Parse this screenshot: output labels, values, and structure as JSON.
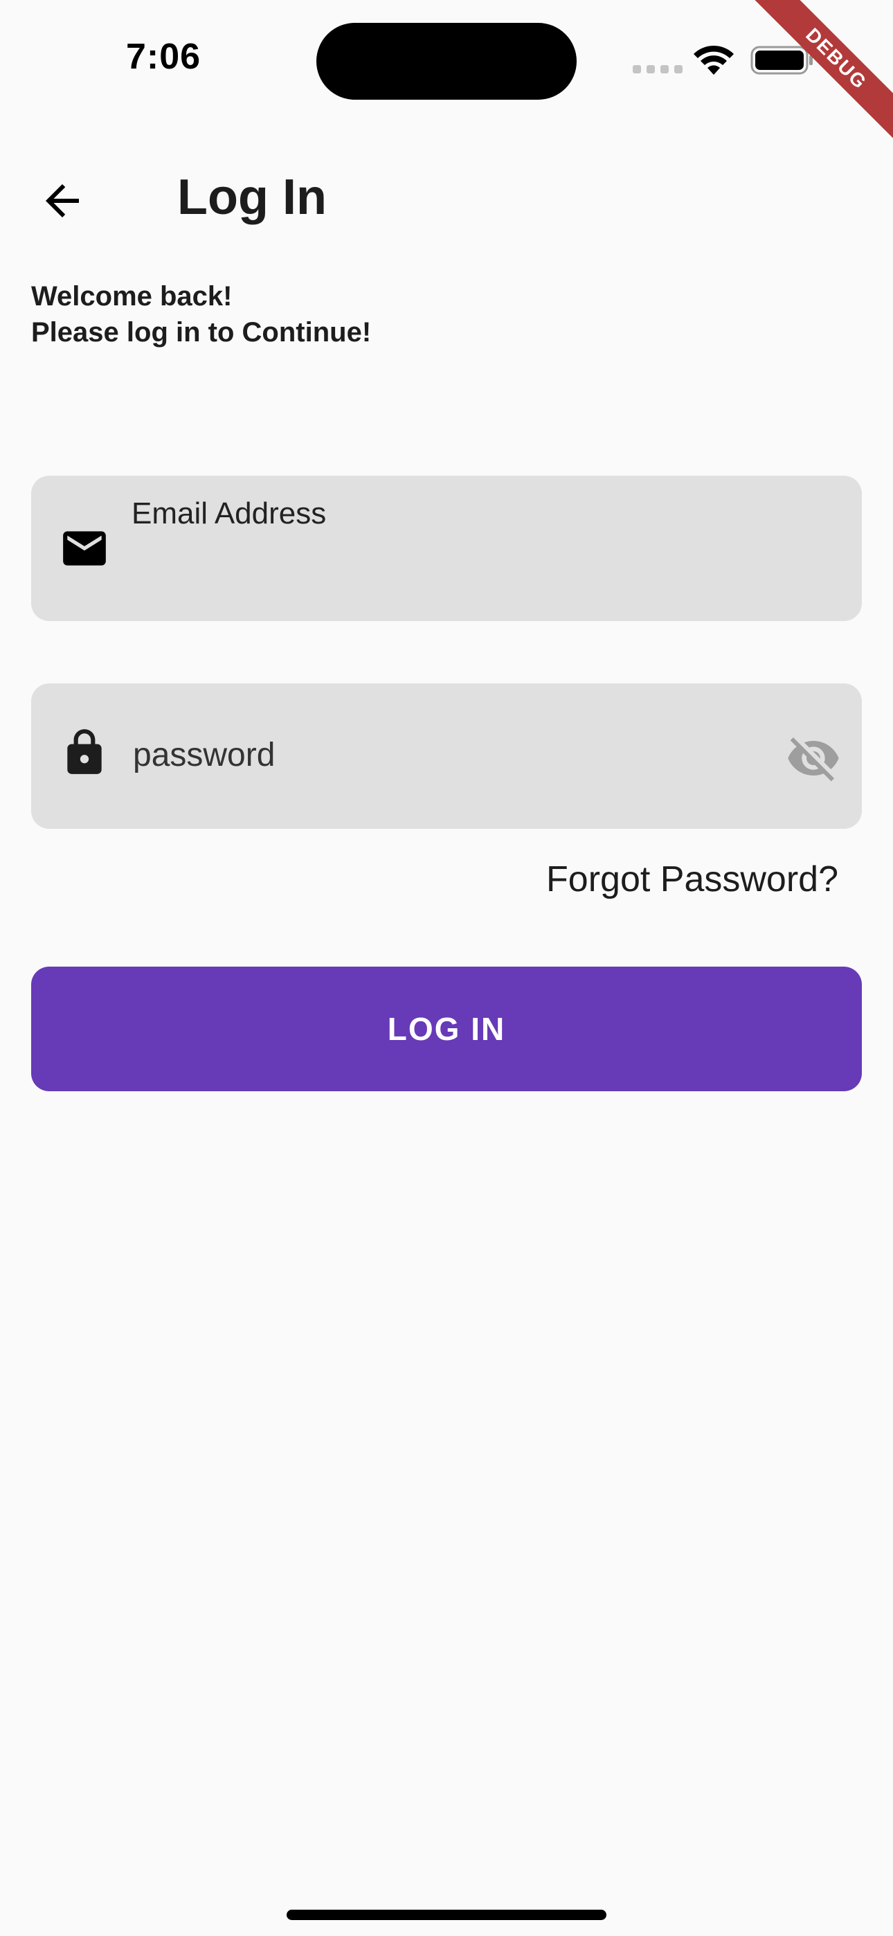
{
  "status_bar": {
    "time": "7:06",
    "icons": [
      "cellular-signal-icon",
      "wifi-icon",
      "battery-icon"
    ]
  },
  "debug_banner": "DEBUG",
  "header": {
    "back_icon": "arrow-back-icon",
    "title": "Log In"
  },
  "welcome": {
    "line1": "Welcome back!",
    "line2": "Please log in to Continue!"
  },
  "form": {
    "email": {
      "icon": "mail-icon",
      "label": "Email Address",
      "value": ""
    },
    "password": {
      "icon": "lock-icon",
      "placeholder": "password",
      "value": "",
      "toggle_icon": "visibility-off-icon"
    },
    "forgot_password": "Forgot Password?",
    "submit_label": "LOG IN"
  },
  "colors": {
    "background": "#fafafa",
    "field_fill": "#e0e0e0",
    "primary": "#673ab7",
    "debug_banner": "#b23a3a"
  }
}
